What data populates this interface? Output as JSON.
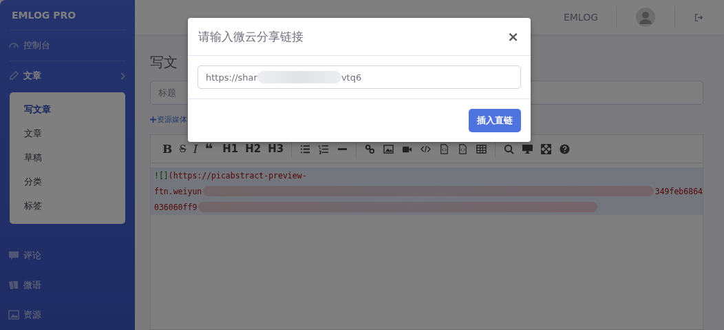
{
  "sidebar": {
    "brand": "EMLOG PRO",
    "items": [
      {
        "label": "控制台",
        "expanded": false
      },
      {
        "label": "文章",
        "expanded": true,
        "children": [
          {
            "label": "写文章",
            "selected": true
          },
          {
            "label": "文章",
            "selected": false
          },
          {
            "label": "草稿",
            "selected": false
          },
          {
            "label": "分类",
            "selected": false
          },
          {
            "label": "标签",
            "selected": false
          }
        ]
      },
      {
        "label": "评论",
        "expanded": false
      },
      {
        "label": "微语",
        "expanded": false
      },
      {
        "label": "资源",
        "expanded": false
      }
    ]
  },
  "topbar": {
    "site": "EMLOG"
  },
  "page": {
    "heading": "写文",
    "title_placeholder": "标题",
    "media_link": "资源媒体",
    "toolbar": [
      "B",
      "S",
      "I",
      "❝",
      "H1",
      "H2",
      "H3"
    ],
    "code_lines": [
      {
        "mark": "![]",
        "text": "(https://picabstract-preview-"
      },
      {
        "text": "ftn.weiyun",
        "tail": "349feb6864"
      },
      {
        "text": "036060ff9"
      }
    ]
  },
  "dialog": {
    "title": "请输入微云分享链接",
    "close": "×",
    "url_start": "https://shar",
    "url_end": "vtq6",
    "button": "插入直链"
  }
}
